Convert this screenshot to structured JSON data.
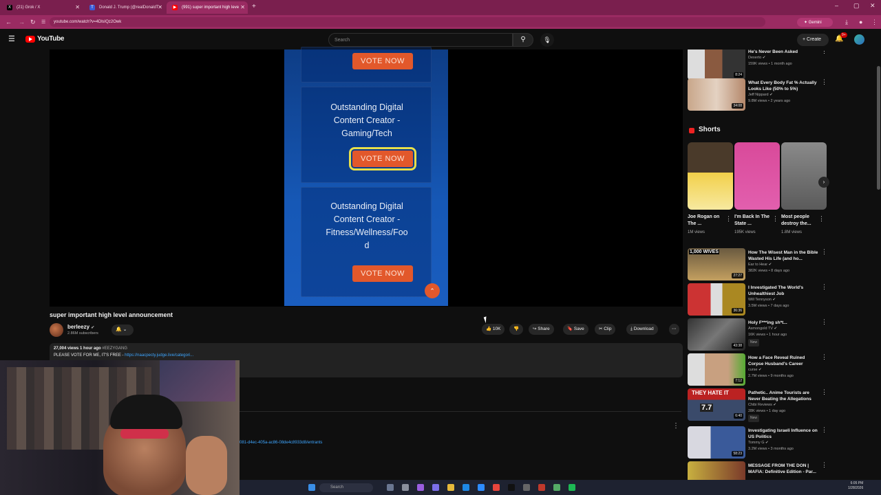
{
  "browser": {
    "tabs": [
      {
        "label": "(21) Grok / X",
        "icon": "x-logo"
      },
      {
        "label": "Donald J. Trump (@realDonaldT",
        "icon": "truth-social-logo"
      },
      {
        "label": "(991) super important high leve",
        "icon": "youtube-logo"
      }
    ],
    "new_tab": "+",
    "url": "youtube.com/watch?v=4DlsIQz2Owk",
    "gemini_label": "Gemini"
  },
  "youtube": {
    "logo_text": "YouTube",
    "search_placeholder": "Search",
    "create_label": "Create",
    "notif_count": "9+"
  },
  "video": {
    "cards": [
      {
        "title": "",
        "button": "VOTE NOW"
      },
      {
        "title": "Outstanding Digital Content Creator - Gaming/Tech",
        "button": "VOTE NOW"
      },
      {
        "title": "Outstanding Digital Content Creator - Fitness/Wellness/Foo d",
        "button": "VOTE NOW"
      }
    ],
    "title_lines": {
      "c2": [
        "Outstanding Digital",
        "Content Creator -",
        "Gaming/Tech"
      ],
      "c3": [
        "Outstanding Digital",
        "Content Creator -",
        "Fitness/Wellness/Foo",
        "d"
      ]
    }
  },
  "meta": {
    "title": "super important high level announcement",
    "channel": "berleezy",
    "subscribers": "2.86M subscribers",
    "likes": "10K",
    "share": "Share",
    "save": "Save",
    "clip": "Clip",
    "download": "Download",
    "views_time": "27,004 views  1 hour ago",
    "hashtag": "#EEZYGANG",
    "desc_text": "PLEASE VOTE FOR ME, IT'S FREE - ",
    "desc_link": "https://naacpecty.judge.live/categori...",
    "link_line": "081-d4ec-405a-ac86-08de4c8933d8/entrants"
  },
  "sidebar": {
    "top": [
      {
        "title": "He's Never Been Asked",
        "channel": "Dexerto",
        "meta": "159K views • 1 month ago",
        "duration": "8:24"
      },
      {
        "title": "What Every Body Fat % Actually Looks Like (50% to 5%)",
        "channel": "Jeff Nippard",
        "meta": "9.8M views • 2 years ago",
        "duration": "34:08"
      }
    ],
    "shorts_heading": "Shorts",
    "shorts": [
      {
        "title": "Joe Rogan on The ...",
        "views": "1M views"
      },
      {
        "title": "I'm Back In The State ...",
        "views": "195K views"
      },
      {
        "title": "Most people destroy the...",
        "views": "1.8M views"
      }
    ],
    "videos": [
      {
        "title": "How The Wisest Man in the Bible Wasted His Life (and ho...",
        "channel": "Ear to Hear",
        "meta": "382K views • 8 days ago",
        "duration": "27:27",
        "new": ""
      },
      {
        "title": "I Investigated The World's Unhealthiest Job",
        "channel": "Will Tennyson",
        "meta": "3.5M views • 7 days ago",
        "duration": "36:36",
        "new": ""
      },
      {
        "title": "Holy F***ing sh*t...",
        "channel": "Asmongold TV",
        "meta": "16K views • 1 hour ago",
        "duration": "43:38",
        "new": "New"
      },
      {
        "title": "How a Face Reveal Ruined Corpse Husband's Career",
        "channel": "curse",
        "meta": "2.7M views • 9 months ago",
        "duration": "7:12",
        "new": ""
      },
      {
        "title": "Pathetic.. Anime Tourists are Never Beating the Allegations",
        "channel": "Chibi Reviews",
        "meta": "28K views • 1 day ago",
        "duration": "6:40",
        "new": "New"
      },
      {
        "title": "Investigating Israeli Influence on US Politics",
        "channel": "Tommy G",
        "meta": "3.2M views • 3 months ago",
        "duration": "58:23",
        "new": ""
      },
      {
        "title": "MESSAGE FROM THE DON | MAFIA: Definitive Edition - Par...",
        "channel": "",
        "meta": "",
        "duration": "",
        "new": ""
      }
    ],
    "thumb_texts": {
      "wives": "1,000 WIVES",
      "hate": "THEY HATE IT",
      "rating": "7.7"
    }
  },
  "taskbar": {
    "search": "Search",
    "time": "6:05 PM",
    "date": "1/28/2026"
  },
  "colors": {
    "chrome": "#7a1f4e",
    "vote": "#e2582b",
    "panel": "#1658b6",
    "highlight": "#e8e04a"
  }
}
